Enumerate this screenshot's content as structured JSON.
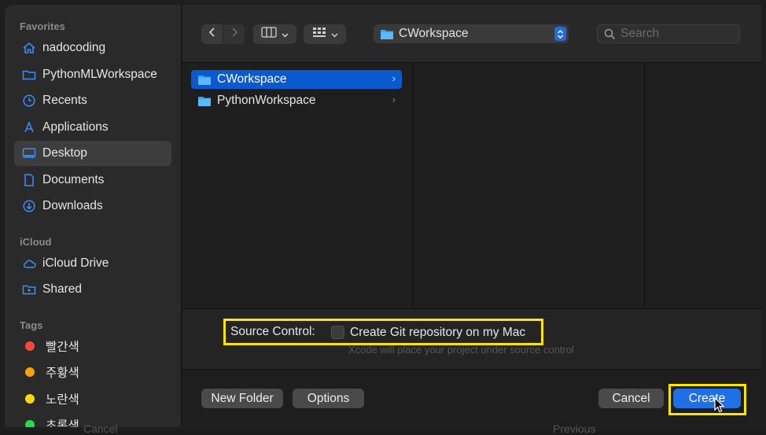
{
  "sidebar": {
    "favorites_header": "Favorites",
    "favorites": [
      {
        "label": "nadocoding",
        "icon": "home-icon"
      },
      {
        "label": "PythonMLWorkspace",
        "icon": "folder-icon"
      },
      {
        "label": "Recents",
        "icon": "clock-icon"
      },
      {
        "label": "Applications",
        "icon": "applications-icon"
      },
      {
        "label": "Desktop",
        "icon": "desktop-icon",
        "selected": true
      },
      {
        "label": "Documents",
        "icon": "document-icon"
      },
      {
        "label": "Downloads",
        "icon": "download-icon"
      }
    ],
    "icloud_header": "iCloud",
    "icloud": [
      {
        "label": "iCloud Drive",
        "icon": "cloud-icon"
      },
      {
        "label": "Shared",
        "icon": "shared-folder-icon"
      }
    ],
    "tags_header": "Tags",
    "tags": [
      {
        "label": "빨간색",
        "color": "#ff453a"
      },
      {
        "label": "주황색",
        "color": "#ff9f0a"
      },
      {
        "label": "노란색",
        "color": "#ffd60a"
      },
      {
        "label": "초록색",
        "color": "#32d74b"
      }
    ]
  },
  "toolbar": {
    "path_folder": "CWorkspace",
    "search_placeholder": "Search"
  },
  "browser": {
    "items": [
      {
        "label": "CWorkspace",
        "selected": true
      },
      {
        "label": "PythonWorkspace",
        "selected": false
      }
    ]
  },
  "options": {
    "source_control_label": "Source Control:",
    "git_checkbox_label": "Create Git repository on my Mac",
    "git_checked": false,
    "hint": "Xcode will place your project under source control"
  },
  "footer": {
    "new_folder": "New Folder",
    "options": "Options",
    "cancel": "Cancel",
    "create": "Create"
  },
  "background": {
    "cancel_ghost": "Cancel",
    "previous_ghost": "Previous"
  },
  "colors": {
    "accent": "#1f6fe5",
    "highlight": "#ffe500"
  }
}
